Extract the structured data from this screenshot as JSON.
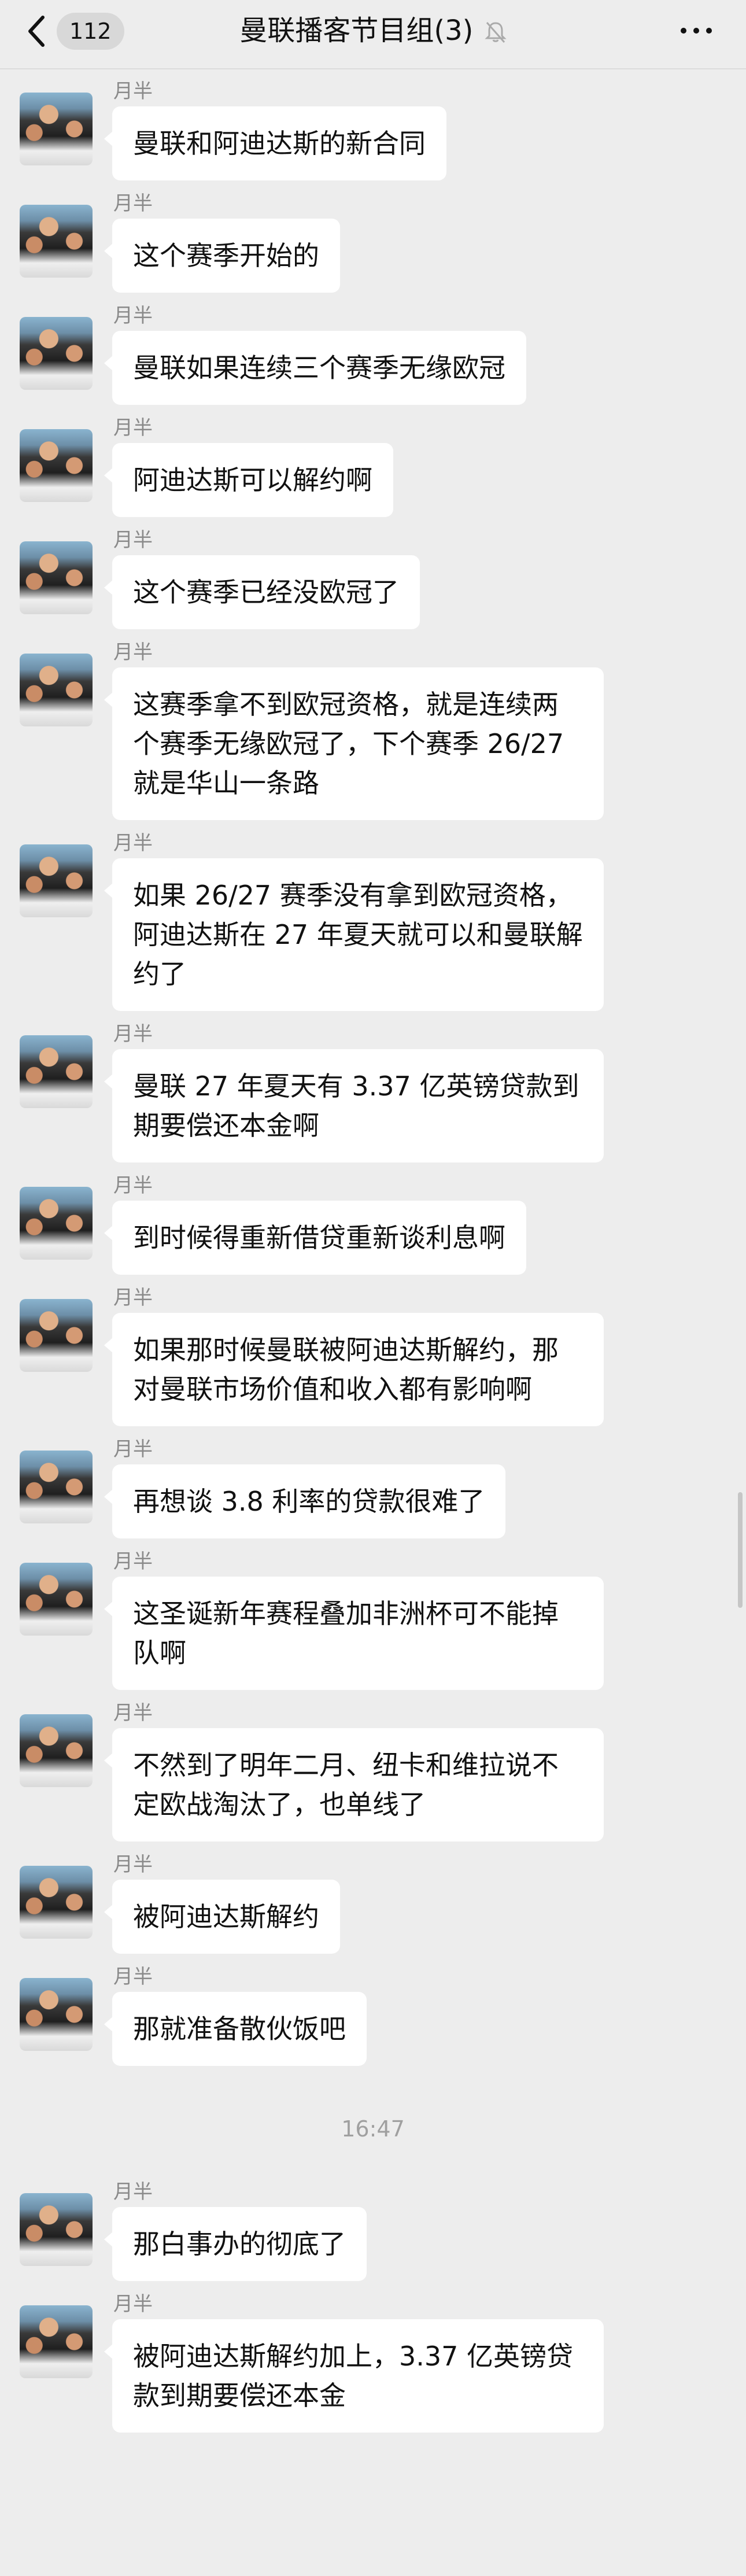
{
  "header": {
    "unread_count": "112",
    "title": "曼联播客节目组(3)"
  },
  "messages": [
    {
      "sender": "月半",
      "text": "曼联和阿迪达斯的新合同"
    },
    {
      "sender": "月半",
      "text": "这个赛季开始的"
    },
    {
      "sender": "月半",
      "text": "曼联如果连续三个赛季无缘欧冠"
    },
    {
      "sender": "月半",
      "text": "阿迪达斯可以解约啊"
    },
    {
      "sender": "月半",
      "text": "这个赛季已经没欧冠了"
    },
    {
      "sender": "月半",
      "text": "这赛季拿不到欧冠资格，就是连续两个赛季无缘欧冠了，下个赛季 26/27 就是华山一条路"
    },
    {
      "sender": "月半",
      "text": "如果 26/27 赛季没有拿到欧冠资格，阿迪达斯在 27 年夏天就可以和曼联解约了"
    },
    {
      "sender": "月半",
      "text": "曼联 27 年夏天有 3.37 亿英镑贷款到期要偿还本金啊"
    },
    {
      "sender": "月半",
      "text": "到时候得重新借贷重新谈利息啊"
    },
    {
      "sender": "月半",
      "text": "如果那时候曼联被阿迪达斯解约，那对曼联市场价值和收入都有影响啊"
    },
    {
      "sender": "月半",
      "text": "再想谈 3.8 利率的贷款很难了"
    },
    {
      "sender": "月半",
      "text": "这圣诞新年赛程叠加非洲杯可不能掉队啊"
    },
    {
      "sender": "月半",
      "text": "不然到了明年二月、纽卡和维拉说不定欧战淘汰了，也单线了"
    },
    {
      "sender": "月半",
      "text": "被阿迪达斯解约"
    },
    {
      "sender": "月半",
      "text": "那就准备散伙饭吧"
    }
  ],
  "timestamp": "16:47",
  "messages_after": [
    {
      "sender": "月半",
      "text": "那白事办的彻底了"
    },
    {
      "sender": "月半",
      "text": "被阿迪达斯解约加上，3.37 亿英镑贷款到期要偿还本金"
    }
  ]
}
